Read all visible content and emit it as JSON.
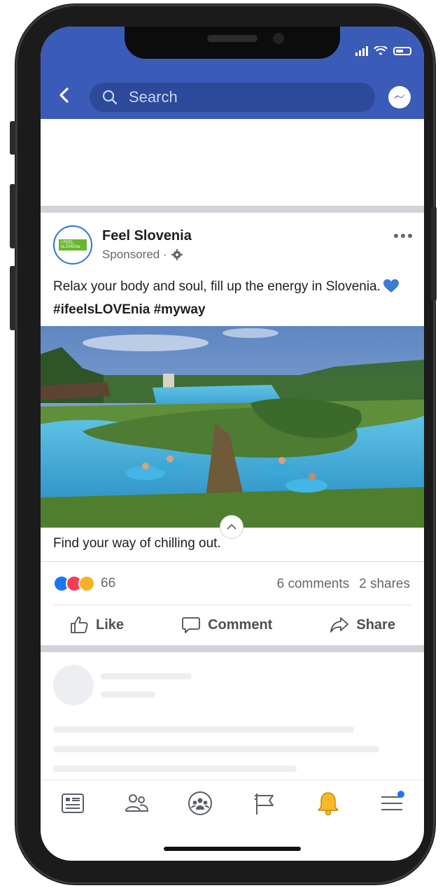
{
  "header": {
    "search_placeholder": "Search"
  },
  "post": {
    "page_name": "Feel Slovenia",
    "sponsored_label": "Sponsored ·",
    "text_plain": "Relax your body and soul, fill up the energy in Slovenia.",
    "hashtags": "#ifeelsLOVEnia #myway",
    "caption": "Find your way of chilling out.",
    "reaction_count": "66",
    "comments": "6 comments",
    "shares": "2 shares"
  },
  "actions": {
    "like": "Like",
    "comment": "Comment",
    "share": "Share"
  },
  "tabs": [
    {
      "name": "news-feed-icon"
    },
    {
      "name": "friends-icon"
    },
    {
      "name": "groups-icon"
    },
    {
      "name": "pages-flag-icon"
    },
    {
      "name": "notifications-bell-icon"
    },
    {
      "name": "menu-icon"
    }
  ],
  "colors": {
    "brand_blue": "#3b5bb8",
    "search_bg": "#2c4a99",
    "bell": "#f7b928",
    "badge": "#1877f2"
  }
}
